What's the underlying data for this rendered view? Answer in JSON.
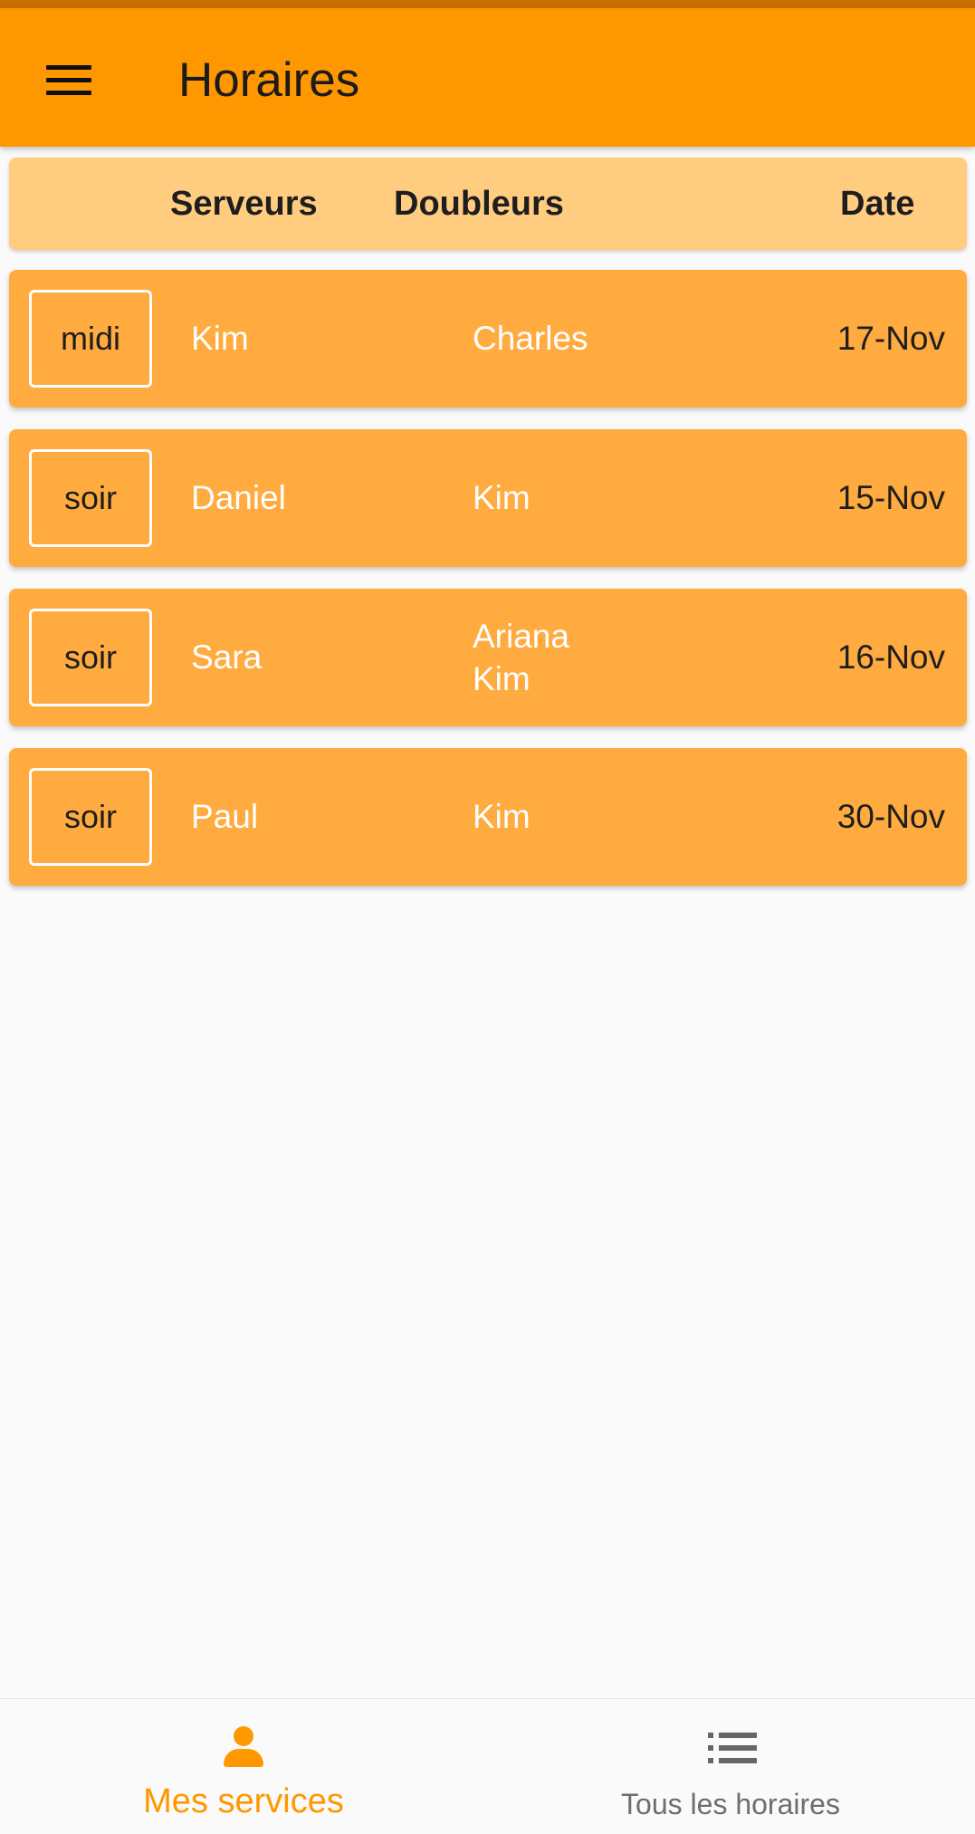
{
  "app_bar": {
    "title": "Horaires",
    "menu_icon": "hamburger-menu-icon"
  },
  "table": {
    "headers": {
      "servers": "Serveurs",
      "doublers": "Doubleurs",
      "date": "Date"
    },
    "rows": [
      {
        "shift": "midi",
        "server": "Kim",
        "doublers": [
          "Charles"
        ],
        "date": "17-Nov"
      },
      {
        "shift": "soir",
        "server": "Daniel",
        "doublers": [
          "Kim"
        ],
        "date": "15-Nov"
      },
      {
        "shift": "soir",
        "server": "Sara",
        "doublers": [
          "Ariana",
          "Kim"
        ],
        "date": "16-Nov"
      },
      {
        "shift": "soir",
        "server": "Paul",
        "doublers": [
          "Kim"
        ],
        "date": "30-Nov"
      }
    ]
  },
  "bottom_nav": {
    "items": [
      {
        "label": "Mes services",
        "icon": "person-icon",
        "active": true
      },
      {
        "label": "Tous les horaires",
        "icon": "list-icon",
        "active": false
      }
    ]
  },
  "colors": {
    "app_bar": "#ff9800",
    "header_card": "#ffcc80",
    "row_card": "#ffab40",
    "active_nav": "#ff9800"
  }
}
